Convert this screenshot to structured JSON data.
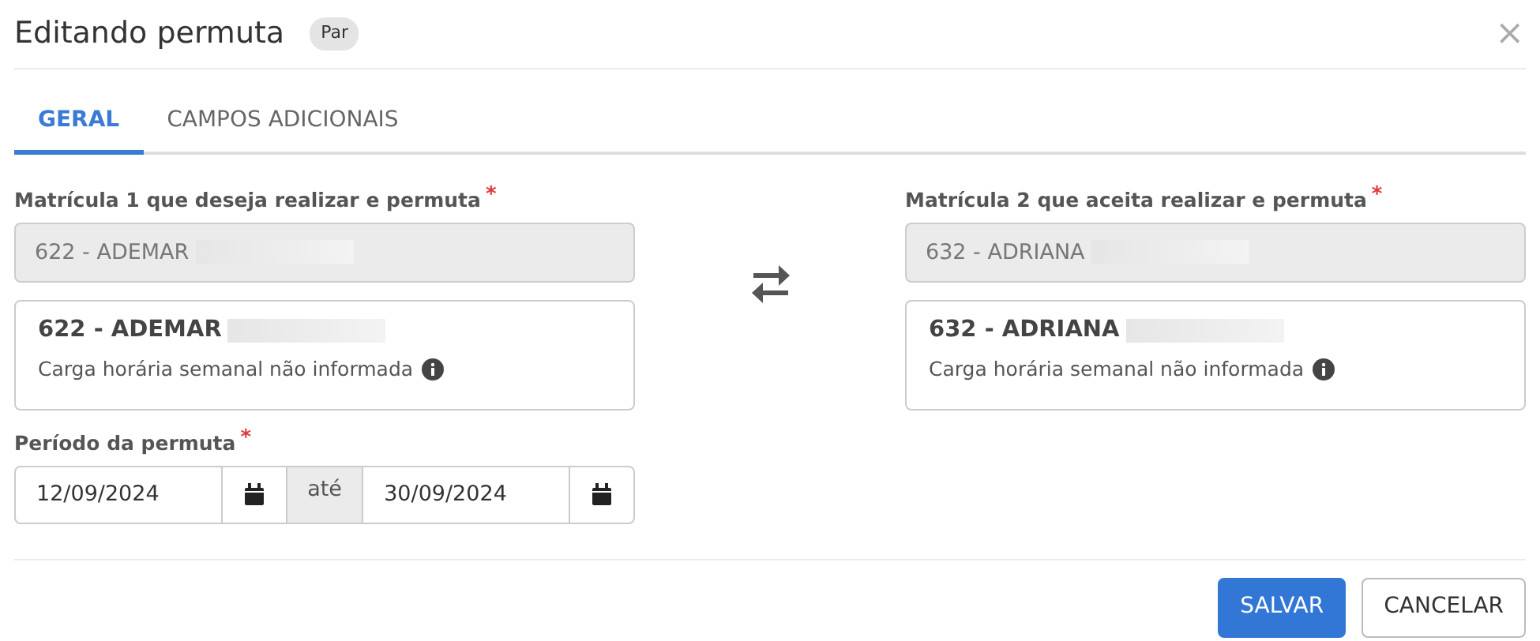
{
  "dialog": {
    "title": "Editando permuta",
    "badge": "Par",
    "close": "×"
  },
  "tabs": [
    {
      "label": "GERAL",
      "selected": true
    },
    {
      "label": "CAMPOS ADICIONAIS",
      "selected": false
    }
  ],
  "left": {
    "label": "Matrícula 1 que deseja realizar e permuta",
    "required_mark": "*",
    "field_value": "622 - ADEMAR",
    "card_title": "622 - ADEMAR",
    "card_note": "Carga horária semanal não informada"
  },
  "right": {
    "label": "Matrícula 2 que aceita realizar e permuta",
    "required_mark": "*",
    "field_value": "632 - ADRIANA",
    "card_title": "632 - ADRIANA",
    "card_note": "Carga horária semanal não informada"
  },
  "period": {
    "label": "Período da permuta",
    "required_mark": "*",
    "start": "12/09/2024",
    "separator": "até",
    "end": "30/09/2024"
  },
  "buttons": [
    {
      "label": "SALVAR",
      "kind": "primary"
    },
    {
      "label": "CANCELAR",
      "kind": "secondary"
    }
  ]
}
